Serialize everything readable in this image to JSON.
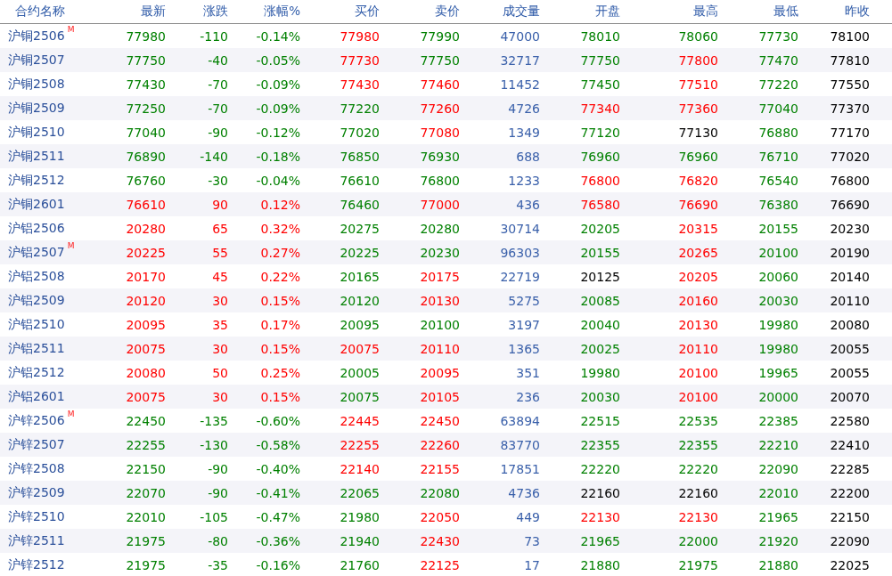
{
  "columns": [
    {
      "label": "合约名称",
      "kind": "name"
    },
    {
      "label": "最新",
      "kind": "price"
    },
    {
      "label": "涨跌",
      "kind": "price"
    },
    {
      "label": "涨幅%",
      "kind": "price"
    },
    {
      "label": "买价",
      "kind": "price"
    },
    {
      "label": "卖价",
      "kind": "price"
    },
    {
      "label": "成交量",
      "kind": "volume"
    },
    {
      "label": "开盘",
      "kind": "price"
    },
    {
      "label": "最高",
      "kind": "price"
    },
    {
      "label": "最低",
      "kind": "price"
    },
    {
      "label": "昨收",
      "kind": "price"
    }
  ],
  "rows": [
    {
      "name": "沪铜2506",
      "badge": "M",
      "cells": [
        {
          "text": "77980",
          "color": "#008000"
        },
        {
          "text": "-110",
          "color": "#008000"
        },
        {
          "text": "-0.14%",
          "color": "#008000"
        },
        {
          "text": "77980",
          "color": "#ff0000"
        },
        {
          "text": "77990",
          "color": "#008000"
        },
        {
          "text": "47000"
        },
        {
          "text": "78010",
          "color": "#008000"
        },
        {
          "text": "78060",
          "color": "#008000"
        },
        {
          "text": "77730",
          "color": "#008000"
        },
        {
          "text": "78100",
          "color": "#000000"
        }
      ]
    },
    {
      "name": "沪铜2507",
      "cells": [
        {
          "text": "77750",
          "color": "#008000"
        },
        {
          "text": "-40",
          "color": "#008000"
        },
        {
          "text": "-0.05%",
          "color": "#008000"
        },
        {
          "text": "77730",
          "color": "#ff0000"
        },
        {
          "text": "77750",
          "color": "#008000"
        },
        {
          "text": "32717"
        },
        {
          "text": "77750",
          "color": "#008000"
        },
        {
          "text": "77800",
          "color": "#ff0000"
        },
        {
          "text": "77470",
          "color": "#008000"
        },
        {
          "text": "77810",
          "color": "#000000"
        }
      ]
    },
    {
      "name": "沪铜2508",
      "cells": [
        {
          "text": "77430",
          "color": "#008000"
        },
        {
          "text": "-70",
          "color": "#008000"
        },
        {
          "text": "-0.09%",
          "color": "#008000"
        },
        {
          "text": "77430",
          "color": "#ff0000"
        },
        {
          "text": "77460",
          "color": "#ff0000"
        },
        {
          "text": "11452"
        },
        {
          "text": "77450",
          "color": "#008000"
        },
        {
          "text": "77510",
          "color": "#ff0000"
        },
        {
          "text": "77220",
          "color": "#008000"
        },
        {
          "text": "77550",
          "color": "#000000"
        }
      ]
    },
    {
      "name": "沪铜2509",
      "cells": [
        {
          "text": "77250",
          "color": "#008000"
        },
        {
          "text": "-70",
          "color": "#008000"
        },
        {
          "text": "-0.09%",
          "color": "#008000"
        },
        {
          "text": "77220",
          "color": "#008000"
        },
        {
          "text": "77260",
          "color": "#ff0000"
        },
        {
          "text": "4726"
        },
        {
          "text": "77340",
          "color": "#ff0000"
        },
        {
          "text": "77360",
          "color": "#ff0000"
        },
        {
          "text": "77040",
          "color": "#008000"
        },
        {
          "text": "77370",
          "color": "#000000"
        }
      ]
    },
    {
      "name": "沪铜2510",
      "cells": [
        {
          "text": "77040",
          "color": "#008000"
        },
        {
          "text": "-90",
          "color": "#008000"
        },
        {
          "text": "-0.12%",
          "color": "#008000"
        },
        {
          "text": "77020",
          "color": "#008000"
        },
        {
          "text": "77080",
          "color": "#ff0000"
        },
        {
          "text": "1349"
        },
        {
          "text": "77120",
          "color": "#008000"
        },
        {
          "text": "77130",
          "color": "#000000"
        },
        {
          "text": "76880",
          "color": "#008000"
        },
        {
          "text": "77170",
          "color": "#000000"
        }
      ]
    },
    {
      "name": "沪铜2511",
      "cells": [
        {
          "text": "76890",
          "color": "#008000"
        },
        {
          "text": "-140",
          "color": "#008000"
        },
        {
          "text": "-0.18%",
          "color": "#008000"
        },
        {
          "text": "76850",
          "color": "#008000"
        },
        {
          "text": "76930",
          "color": "#008000"
        },
        {
          "text": "688"
        },
        {
          "text": "76960",
          "color": "#008000"
        },
        {
          "text": "76960",
          "color": "#008000"
        },
        {
          "text": "76710",
          "color": "#008000"
        },
        {
          "text": "77020",
          "color": "#000000"
        }
      ]
    },
    {
      "name": "沪铜2512",
      "cells": [
        {
          "text": "76760",
          "color": "#008000"
        },
        {
          "text": "-30",
          "color": "#008000"
        },
        {
          "text": "-0.04%",
          "color": "#008000"
        },
        {
          "text": "76610",
          "color": "#008000"
        },
        {
          "text": "76800",
          "color": "#008000"
        },
        {
          "text": "1233"
        },
        {
          "text": "76800",
          "color": "#ff0000"
        },
        {
          "text": "76820",
          "color": "#ff0000"
        },
        {
          "text": "76540",
          "color": "#008000"
        },
        {
          "text": "76800",
          "color": "#000000"
        }
      ]
    },
    {
      "name": "沪铜2601",
      "cells": [
        {
          "text": "76610",
          "color": "#ff0000"
        },
        {
          "text": "90",
          "color": "#ff0000"
        },
        {
          "text": "0.12%",
          "color": "#ff0000"
        },
        {
          "text": "76460",
          "color": "#008000"
        },
        {
          "text": "77000",
          "color": "#ff0000"
        },
        {
          "text": "436"
        },
        {
          "text": "76580",
          "color": "#ff0000"
        },
        {
          "text": "76690",
          "color": "#ff0000"
        },
        {
          "text": "76380",
          "color": "#008000"
        },
        {
          "text": "76690",
          "color": "#000000"
        }
      ]
    },
    {
      "name": "沪铝2506",
      "cells": [
        {
          "text": "20280",
          "color": "#ff0000"
        },
        {
          "text": "65",
          "color": "#ff0000"
        },
        {
          "text": "0.32%",
          "color": "#ff0000"
        },
        {
          "text": "20275",
          "color": "#008000"
        },
        {
          "text": "20280",
          "color": "#008000"
        },
        {
          "text": "30714"
        },
        {
          "text": "20205",
          "color": "#008000"
        },
        {
          "text": "20315",
          "color": "#ff0000"
        },
        {
          "text": "20155",
          "color": "#008000"
        },
        {
          "text": "20230",
          "color": "#000000"
        }
      ]
    },
    {
      "name": "沪铝2507",
      "badge": "M",
      "cells": [
        {
          "text": "20225",
          "color": "#ff0000"
        },
        {
          "text": "55",
          "color": "#ff0000"
        },
        {
          "text": "0.27%",
          "color": "#ff0000"
        },
        {
          "text": "20225",
          "color": "#008000"
        },
        {
          "text": "20230",
          "color": "#008000"
        },
        {
          "text": "96303"
        },
        {
          "text": "20155",
          "color": "#008000"
        },
        {
          "text": "20265",
          "color": "#ff0000"
        },
        {
          "text": "20100",
          "color": "#008000"
        },
        {
          "text": "20190",
          "color": "#000000"
        }
      ]
    },
    {
      "name": "沪铝2508",
      "cells": [
        {
          "text": "20170",
          "color": "#ff0000"
        },
        {
          "text": "45",
          "color": "#ff0000"
        },
        {
          "text": "0.22%",
          "color": "#ff0000"
        },
        {
          "text": "20165",
          "color": "#008000"
        },
        {
          "text": "20175",
          "color": "#ff0000"
        },
        {
          "text": "22719"
        },
        {
          "text": "20125",
          "color": "#000000"
        },
        {
          "text": "20205",
          "color": "#ff0000"
        },
        {
          "text": "20060",
          "color": "#008000"
        },
        {
          "text": "20140",
          "color": "#000000"
        }
      ]
    },
    {
      "name": "沪铝2509",
      "cells": [
        {
          "text": "20120",
          "color": "#ff0000"
        },
        {
          "text": "30",
          "color": "#ff0000"
        },
        {
          "text": "0.15%",
          "color": "#ff0000"
        },
        {
          "text": "20120",
          "color": "#008000"
        },
        {
          "text": "20130",
          "color": "#ff0000"
        },
        {
          "text": "5275"
        },
        {
          "text": "20085",
          "color": "#008000"
        },
        {
          "text": "20160",
          "color": "#ff0000"
        },
        {
          "text": "20030",
          "color": "#008000"
        },
        {
          "text": "20110",
          "color": "#000000"
        }
      ]
    },
    {
      "name": "沪铝2510",
      "cells": [
        {
          "text": "20095",
          "color": "#ff0000"
        },
        {
          "text": "35",
          "color": "#ff0000"
        },
        {
          "text": "0.17%",
          "color": "#ff0000"
        },
        {
          "text": "20095",
          "color": "#008000"
        },
        {
          "text": "20100",
          "color": "#008000"
        },
        {
          "text": "3197"
        },
        {
          "text": "20040",
          "color": "#008000"
        },
        {
          "text": "20130",
          "color": "#ff0000"
        },
        {
          "text": "19980",
          "color": "#008000"
        },
        {
          "text": "20080",
          "color": "#000000"
        }
      ]
    },
    {
      "name": "沪铝2511",
      "cells": [
        {
          "text": "20075",
          "color": "#ff0000"
        },
        {
          "text": "30",
          "color": "#ff0000"
        },
        {
          "text": "0.15%",
          "color": "#ff0000"
        },
        {
          "text": "20075",
          "color": "#ff0000"
        },
        {
          "text": "20110",
          "color": "#ff0000"
        },
        {
          "text": "1365"
        },
        {
          "text": "20025",
          "color": "#008000"
        },
        {
          "text": "20110",
          "color": "#ff0000"
        },
        {
          "text": "19980",
          "color": "#008000"
        },
        {
          "text": "20055",
          "color": "#000000"
        }
      ]
    },
    {
      "name": "沪铝2512",
      "cells": [
        {
          "text": "20080",
          "color": "#ff0000"
        },
        {
          "text": "50",
          "color": "#ff0000"
        },
        {
          "text": "0.25%",
          "color": "#ff0000"
        },
        {
          "text": "20005",
          "color": "#008000"
        },
        {
          "text": "20095",
          "color": "#ff0000"
        },
        {
          "text": "351"
        },
        {
          "text": "19980",
          "color": "#008000"
        },
        {
          "text": "20100",
          "color": "#ff0000"
        },
        {
          "text": "19965",
          "color": "#008000"
        },
        {
          "text": "20055",
          "color": "#000000"
        }
      ]
    },
    {
      "name": "沪铝2601",
      "cells": [
        {
          "text": "20075",
          "color": "#ff0000"
        },
        {
          "text": "30",
          "color": "#ff0000"
        },
        {
          "text": "0.15%",
          "color": "#ff0000"
        },
        {
          "text": "20075",
          "color": "#008000"
        },
        {
          "text": "20105",
          "color": "#ff0000"
        },
        {
          "text": "236"
        },
        {
          "text": "20030",
          "color": "#008000"
        },
        {
          "text": "20100",
          "color": "#ff0000"
        },
        {
          "text": "20000",
          "color": "#008000"
        },
        {
          "text": "20070",
          "color": "#000000"
        }
      ]
    },
    {
      "name": "沪锌2506",
      "badge": "M",
      "cells": [
        {
          "text": "22450",
          "color": "#008000"
        },
        {
          "text": "-135",
          "color": "#008000"
        },
        {
          "text": "-0.60%",
          "color": "#008000"
        },
        {
          "text": "22445",
          "color": "#ff0000"
        },
        {
          "text": "22450",
          "color": "#ff0000"
        },
        {
          "text": "63894"
        },
        {
          "text": "22515",
          "color": "#008000"
        },
        {
          "text": "22535",
          "color": "#008000"
        },
        {
          "text": "22385",
          "color": "#008000"
        },
        {
          "text": "22580",
          "color": "#000000"
        }
      ]
    },
    {
      "name": "沪锌2507",
      "cells": [
        {
          "text": "22255",
          "color": "#008000"
        },
        {
          "text": "-130",
          "color": "#008000"
        },
        {
          "text": "-0.58%",
          "color": "#008000"
        },
        {
          "text": "22255",
          "color": "#ff0000"
        },
        {
          "text": "22260",
          "color": "#ff0000"
        },
        {
          "text": "83770"
        },
        {
          "text": "22355",
          "color": "#008000"
        },
        {
          "text": "22355",
          "color": "#008000"
        },
        {
          "text": "22210",
          "color": "#008000"
        },
        {
          "text": "22410",
          "color": "#000000"
        }
      ]
    },
    {
      "name": "沪锌2508",
      "cells": [
        {
          "text": "22150",
          "color": "#008000"
        },
        {
          "text": "-90",
          "color": "#008000"
        },
        {
          "text": "-0.40%",
          "color": "#008000"
        },
        {
          "text": "22140",
          "color": "#ff0000"
        },
        {
          "text": "22155",
          "color": "#ff0000"
        },
        {
          "text": "17851"
        },
        {
          "text": "22220",
          "color": "#008000"
        },
        {
          "text": "22220",
          "color": "#008000"
        },
        {
          "text": "22090",
          "color": "#008000"
        },
        {
          "text": "22285",
          "color": "#000000"
        }
      ]
    },
    {
      "name": "沪锌2509",
      "cells": [
        {
          "text": "22070",
          "color": "#008000"
        },
        {
          "text": "-90",
          "color": "#008000"
        },
        {
          "text": "-0.41%",
          "color": "#008000"
        },
        {
          "text": "22065",
          "color": "#008000"
        },
        {
          "text": "22080",
          "color": "#008000"
        },
        {
          "text": "4736"
        },
        {
          "text": "22160",
          "color": "#000000"
        },
        {
          "text": "22160",
          "color": "#000000"
        },
        {
          "text": "22010",
          "color": "#008000"
        },
        {
          "text": "22200",
          "color": "#000000"
        }
      ]
    },
    {
      "name": "沪锌2510",
      "cells": [
        {
          "text": "22010",
          "color": "#008000"
        },
        {
          "text": "-105",
          "color": "#008000"
        },
        {
          "text": "-0.47%",
          "color": "#008000"
        },
        {
          "text": "21980",
          "color": "#008000"
        },
        {
          "text": "22050",
          "color": "#ff0000"
        },
        {
          "text": "449"
        },
        {
          "text": "22130",
          "color": "#ff0000"
        },
        {
          "text": "22130",
          "color": "#ff0000"
        },
        {
          "text": "21965",
          "color": "#008000"
        },
        {
          "text": "22150",
          "color": "#000000"
        }
      ]
    },
    {
      "name": "沪锌2511",
      "cells": [
        {
          "text": "21975",
          "color": "#008000"
        },
        {
          "text": "-80",
          "color": "#008000"
        },
        {
          "text": "-0.36%",
          "color": "#008000"
        },
        {
          "text": "21940",
          "color": "#008000"
        },
        {
          "text": "22430",
          "color": "#ff0000"
        },
        {
          "text": "73"
        },
        {
          "text": "21965",
          "color": "#008000"
        },
        {
          "text": "22000",
          "color": "#008000"
        },
        {
          "text": "21920",
          "color": "#008000"
        },
        {
          "text": "22090",
          "color": "#000000"
        }
      ]
    },
    {
      "name": "沪锌2512",
      "cells": [
        {
          "text": "21975",
          "color": "#008000"
        },
        {
          "text": "-35",
          "color": "#008000"
        },
        {
          "text": "-0.16%",
          "color": "#008000"
        },
        {
          "text": "21760",
          "color": "#008000"
        },
        {
          "text": "22125",
          "color": "#ff0000"
        },
        {
          "text": "17"
        },
        {
          "text": "21880",
          "color": "#008000"
        },
        {
          "text": "21975",
          "color": "#008000"
        },
        {
          "text": "21880",
          "color": "#008000"
        },
        {
          "text": "22025",
          "color": "#000000"
        }
      ]
    }
  ]
}
